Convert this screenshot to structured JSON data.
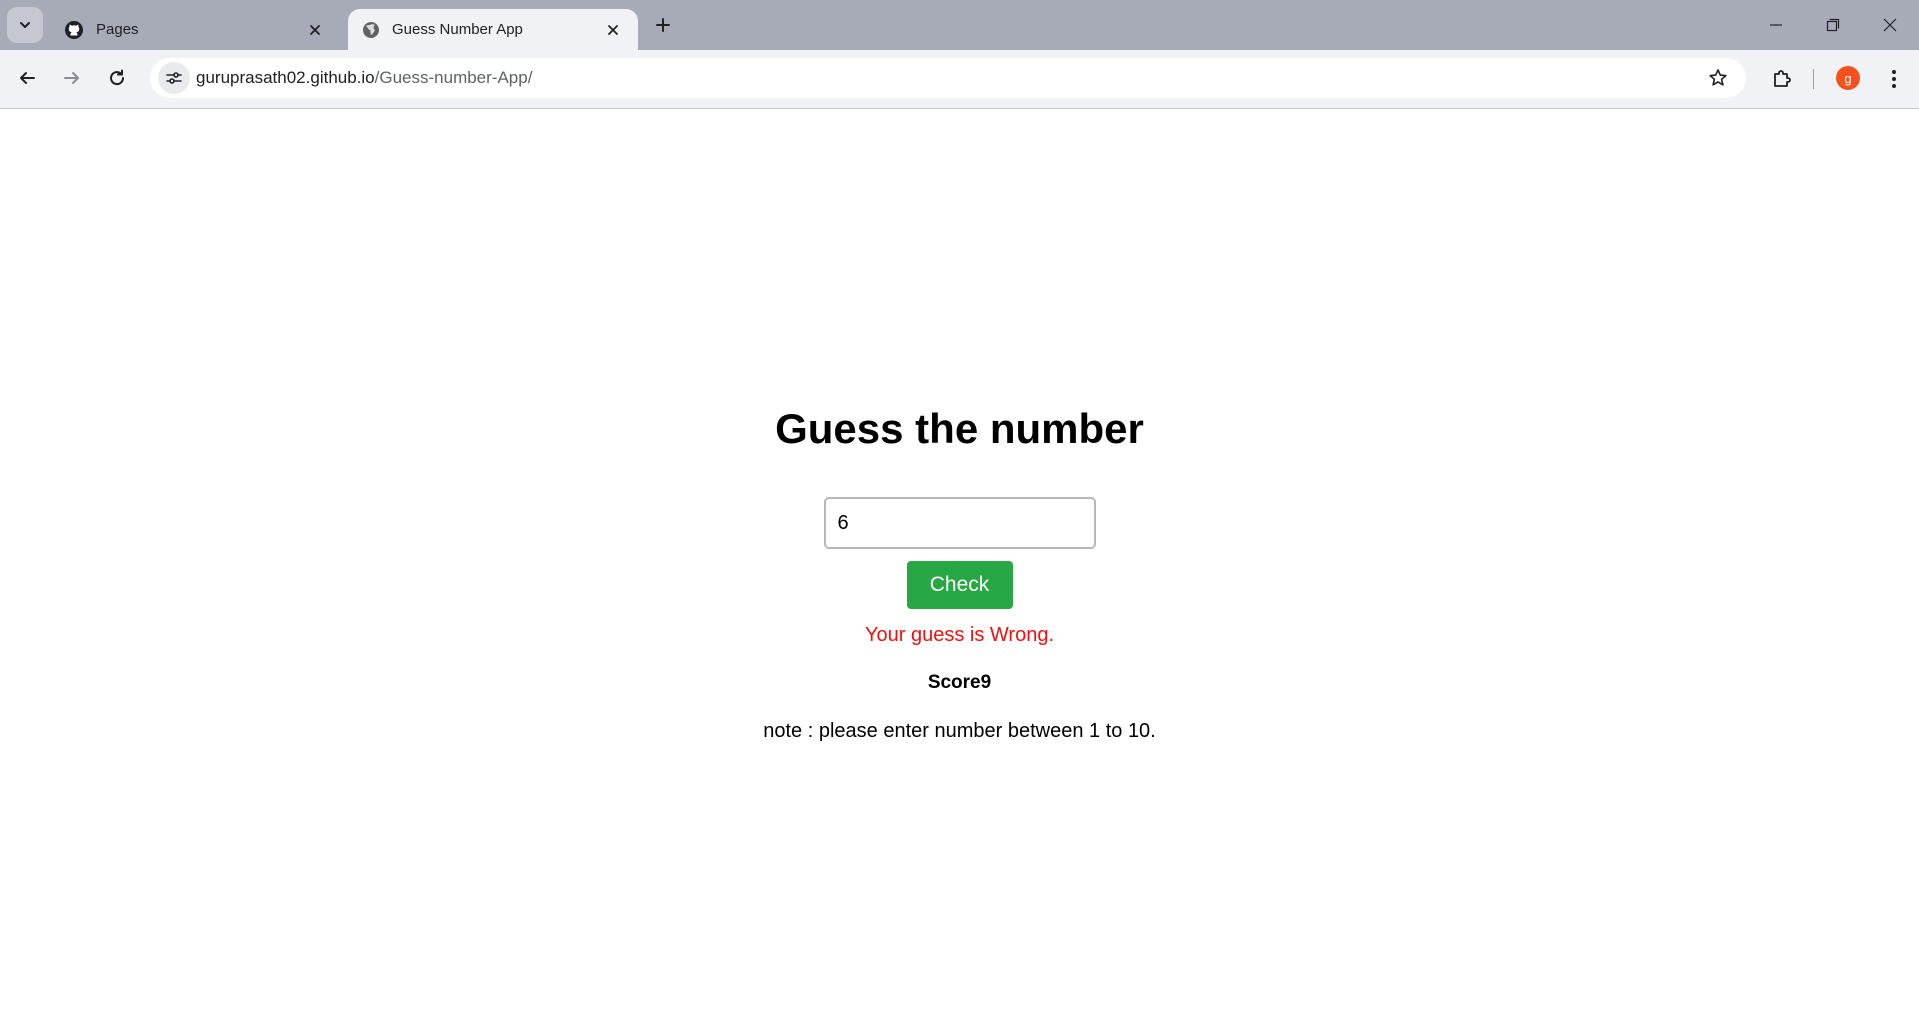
{
  "browser": {
    "tabs": [
      {
        "title": "Pages",
        "icon": "github-icon",
        "active": false
      },
      {
        "title": "Guess Number App",
        "icon": "globe-icon",
        "active": true
      }
    ],
    "url": {
      "domain": "guruprasath02.github.io",
      "path": "/Guess-number-App/"
    },
    "profile_initial": "g",
    "colors": {
      "tabbar": "#a7abb8",
      "toolbar": "#f1f2f5",
      "profile": "#f4511e"
    }
  },
  "app": {
    "title": "Guess the number",
    "input": {
      "value": "6",
      "placeholder": ""
    },
    "check_label": "Check",
    "result": "Your guess is Wrong.",
    "score": "Score9",
    "note": "note : please enter number between 1 to 10.",
    "colors": {
      "button": "#28a745",
      "result": "#ee1111"
    }
  }
}
